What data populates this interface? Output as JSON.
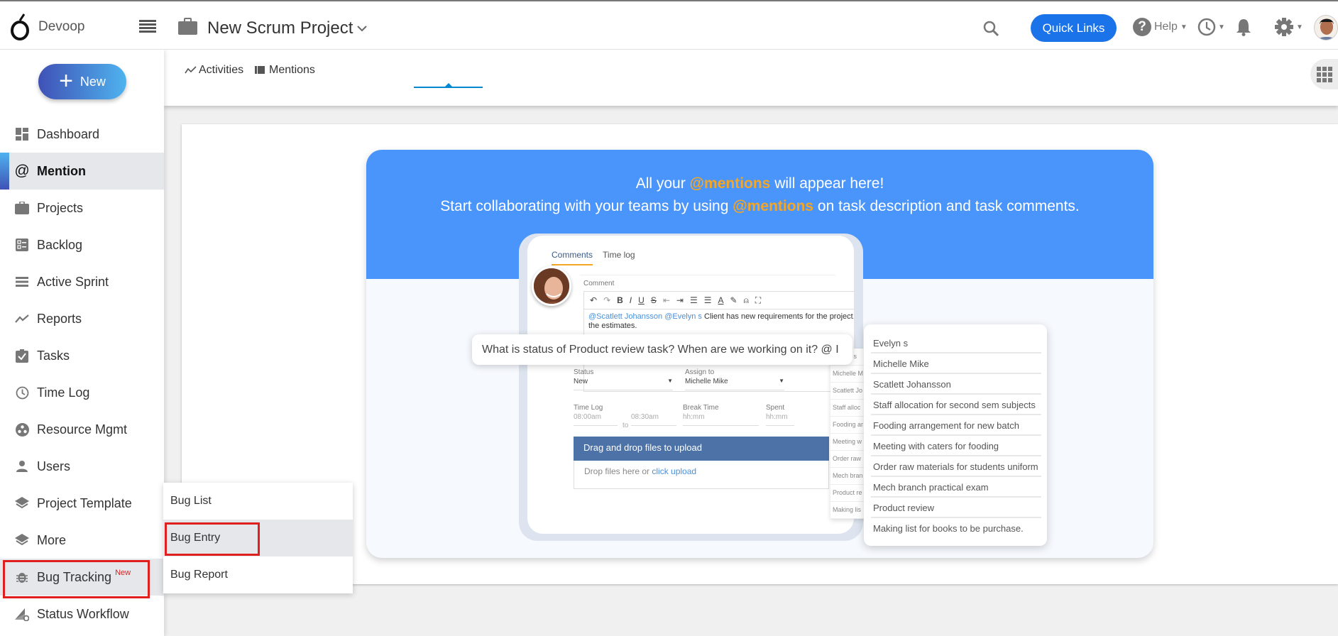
{
  "header": {
    "brand": "Devoop",
    "project_title": "New Scrum Project",
    "quick_links_label": "Quick Links",
    "help_label": "Help",
    "icons": [
      "logo-icon",
      "hamburger-menu-icon",
      "briefcase-icon",
      "chevron-down-icon",
      "search-icon",
      "help-icon",
      "clock-icon",
      "bell-icon",
      "gear-icon",
      "user-avatar"
    ]
  },
  "sidebar": {
    "new_button_label": "New",
    "items": [
      {
        "label": "Dashboard",
        "icon": "dashboard-icon"
      },
      {
        "label": "Mention",
        "icon": "at-sign-icon",
        "active": true
      },
      {
        "label": "Projects",
        "icon": "briefcase-icon"
      },
      {
        "label": "Backlog",
        "icon": "backlog-icon"
      },
      {
        "label": "Active Sprint",
        "icon": "sprint-icon"
      },
      {
        "label": "Reports",
        "icon": "trend-line-icon"
      },
      {
        "label": "Tasks",
        "icon": "clipboard-check-icon"
      },
      {
        "label": "Time Log",
        "icon": "clock-icon"
      },
      {
        "label": "Resource Mgmt",
        "icon": "resource-icon"
      },
      {
        "label": "Users",
        "icon": "user-icon"
      },
      {
        "label": "Project Template",
        "icon": "layers-icon"
      },
      {
        "label": "More",
        "icon": "layers-icon"
      },
      {
        "label": "Bug Tracking",
        "icon": "bug-icon",
        "badge": "New",
        "highlighted": true
      },
      {
        "label": "Status Workflow",
        "icon": "workflow-icon"
      }
    ]
  },
  "tabs": [
    {
      "label": "Activities",
      "icon": "activity-icon"
    },
    {
      "label": "Mentions",
      "icon": "mentions-icon",
      "active": true
    }
  ],
  "banner": {
    "line1_pre": "All your ",
    "line1_hl": "@mentions",
    "line1_post": " will appear here!",
    "line2_pre": "Start collaborating with your teams by using ",
    "line2_hl": "@mentions",
    "line2_post": " on task description and task comments.",
    "colors": {
      "blue": "#4a95fb",
      "highlight": "#f5a623"
    }
  },
  "mockup": {
    "tabs": [
      "Comments",
      "Time log"
    ],
    "comment_label": "Comment",
    "comment_mentions": [
      "@Scatlett Johansson",
      "@Evelyn s"
    ],
    "comment_text": " Client has new requirements for the project. Please review and let know the estimates.",
    "status_label": "Status",
    "status_value": "New",
    "assign_label": "Assign to",
    "assign_value": "Michelle Mike",
    "timelog_label": "Time Log",
    "time_from": "08:00am",
    "time_to_word": "to",
    "time_to": "08:30am",
    "break_label": "Break Time",
    "break_placeholder": "hh:mm",
    "spent_label": "Spent",
    "spent_placeholder": "hh:mm",
    "drop_header": "Drag and drop files to upload",
    "drop_text": "Drop files here or ",
    "drop_link": "click upload",
    "bubble_text": "What is status of Product review task? When are we working on it? @ I",
    "mini_list": [
      "Evelyn s",
      "Michelle M",
      "Scatlett Jo",
      "Staff alloc",
      "Fooding ar",
      "Meeting w",
      "Order raw",
      "Mech bran",
      "Product re",
      "Making lis"
    ],
    "suggestions": [
      "Evelyn s",
      "Michelle Mike",
      "Scatlett Johansson",
      "Staff allocation for second sem subjects",
      "Fooding arrangement for new batch",
      "Meeting with caters for fooding",
      "Order raw materials for students uniform",
      "Mech branch practical exam",
      "Product review",
      "Making list for books to be purchase."
    ]
  },
  "submenu": {
    "items": [
      {
        "label": "Bug List"
      },
      {
        "label": "Bug Entry",
        "selected": true
      },
      {
        "label": "Bug Report"
      }
    ]
  },
  "colors": {
    "accent_blue": "#1a73e8",
    "highlight_red": "#e0201e"
  }
}
